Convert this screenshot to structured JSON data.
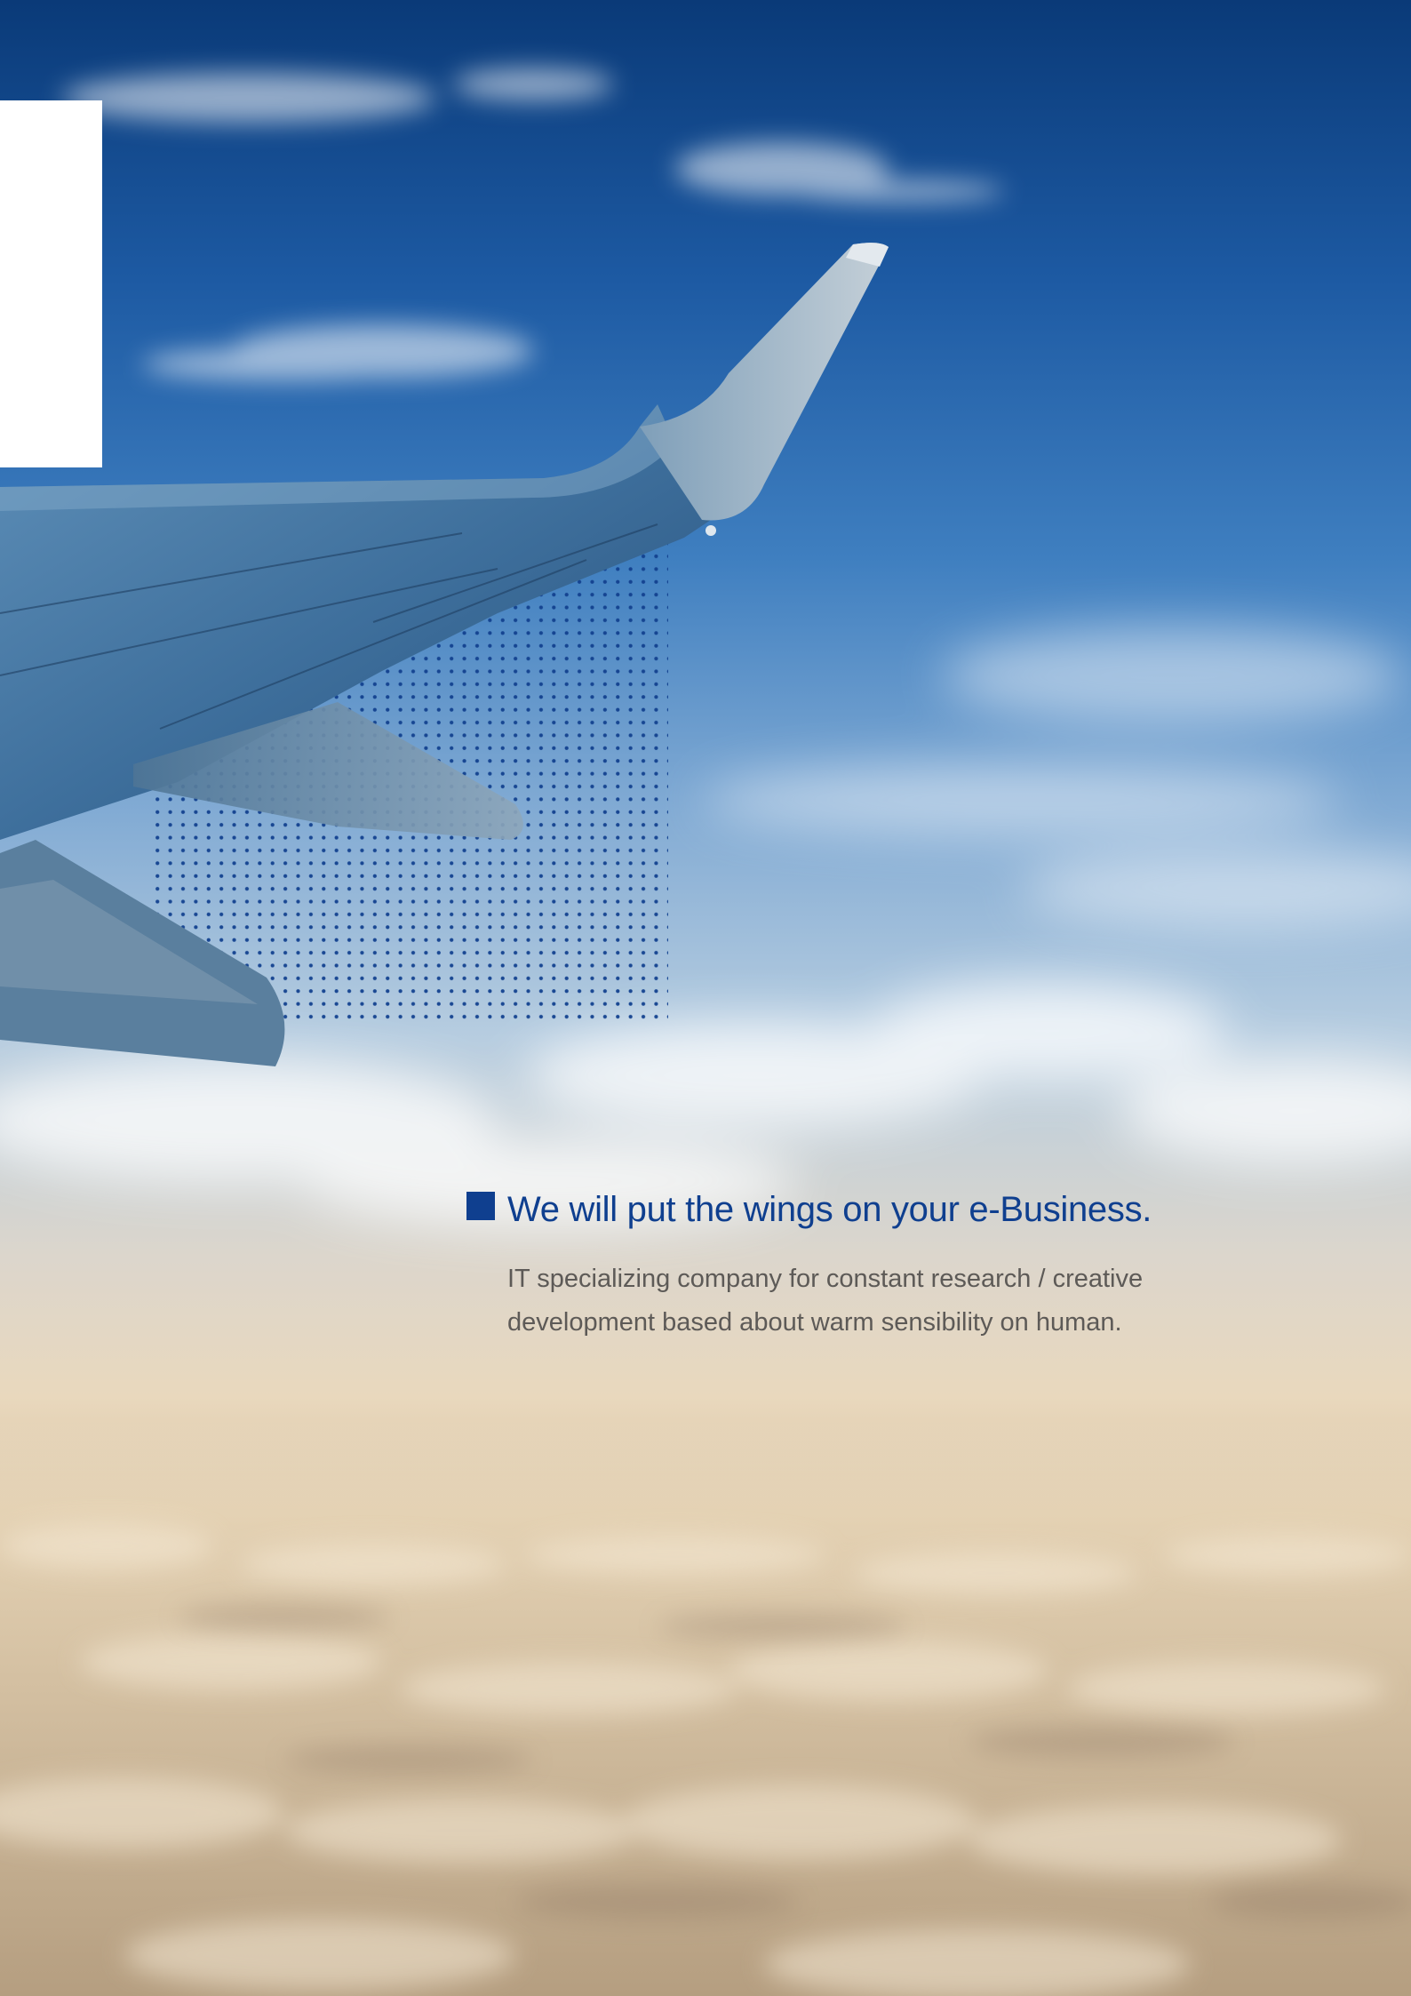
{
  "background": {
    "sky_top_color": "#0a3a78",
    "horizon_color": "#e9d8bd",
    "cloud_color": "#c4ad8f",
    "accent_color": "#0f3f8f"
  },
  "tagline": {
    "headline": "We will put the wings on your e-Business.",
    "body_lines": [
      "IT specializing company for constant research / creative",
      "development based about warm sensibility on human."
    ]
  }
}
